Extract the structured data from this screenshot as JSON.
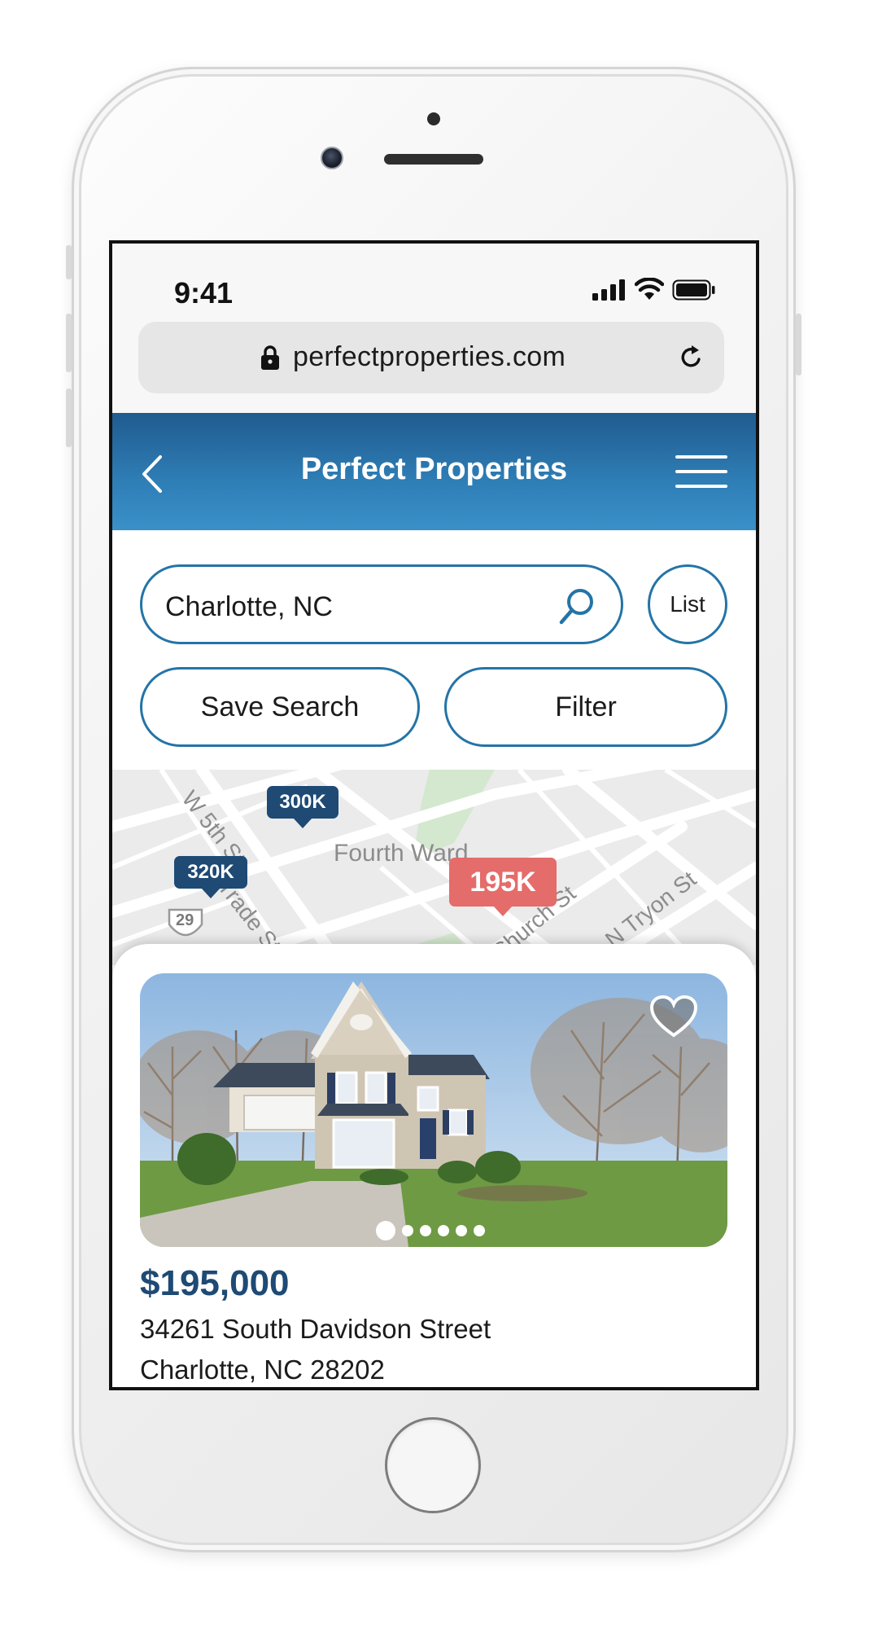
{
  "status_bar": {
    "time": "9:41",
    "icons": [
      "signal-icon",
      "wifi-icon",
      "battery-icon"
    ]
  },
  "browser": {
    "url": "perfectproperties.com",
    "icons": [
      "lock-icon",
      "reload-icon"
    ]
  },
  "header": {
    "title": "Perfect Properties",
    "icons": [
      "back-chevron-icon",
      "hamburger-menu-icon"
    ]
  },
  "search": {
    "value": "Charlotte, NC",
    "list_label": "List"
  },
  "actions": {
    "save_search": "Save Search",
    "filter": "Filter"
  },
  "map": {
    "labels": [
      "W 5th St",
      "Fourth Ward",
      "Trade St",
      "Church St",
      "N Tryon St"
    ],
    "route_badge": "29",
    "markers": [
      {
        "label": "300K",
        "selected": false
      },
      {
        "label": "320K",
        "selected": false
      },
      {
        "label": "195K",
        "selected": true
      }
    ]
  },
  "listing": {
    "price": "$195,000",
    "address_line1": "34261 South Davidson Street",
    "address_line2": "Charlotte, NC 28202",
    "photo_count": 6,
    "active_photo": 1,
    "favorite": false
  },
  "colors": {
    "brand_dark": "#1e4a74",
    "brand_light": "#3a90c8",
    "accent_red": "#e46c6a",
    "outline": "#2474a6"
  }
}
